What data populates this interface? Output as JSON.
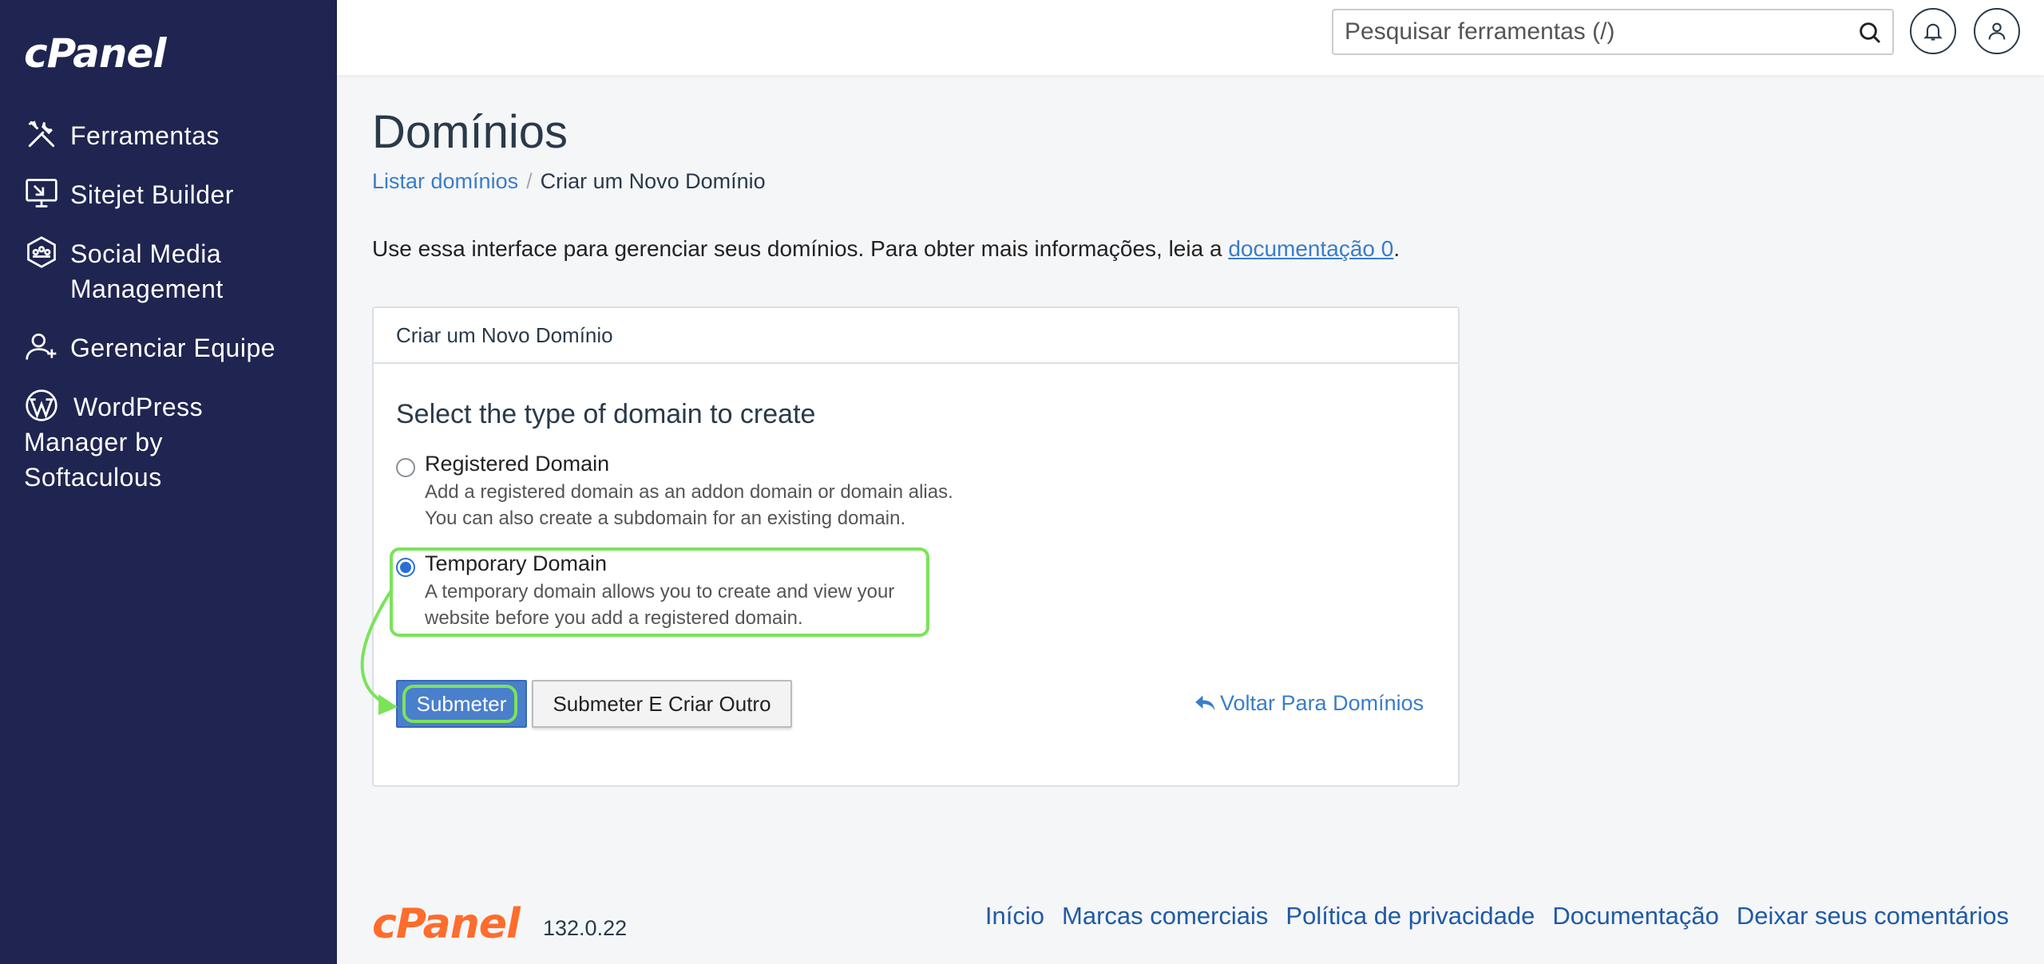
{
  "sidebar": {
    "logo": "cPanel",
    "items": [
      {
        "label": "Ferramentas",
        "icon": "tools-icon"
      },
      {
        "label": "Sitejet Builder",
        "icon": "sitejet-icon"
      },
      {
        "label": "Social Media Management",
        "icon": "social-media-icon"
      },
      {
        "label": "Gerenciar Equipe",
        "icon": "team-icon"
      },
      {
        "label": "WordPress Manager by Softaculous",
        "icon": "wordpress-icon"
      }
    ]
  },
  "topbar": {
    "search_placeholder": "Pesquisar ferramentas (/)"
  },
  "page": {
    "title": "Domínios",
    "breadcrumb": {
      "link": "Listar domínios",
      "current": "Criar um Novo Domínio"
    },
    "intro_text": "Use essa interface para gerenciar seus domínios. Para obter mais informações, leia a",
    "intro_link": "documentação",
    "intro_link_suffix": "0",
    "intro_end": "."
  },
  "panel": {
    "header": "Criar um Novo Domínio",
    "subtitle": "Select the type of domain to create",
    "options": [
      {
        "title": "Registered Domain",
        "desc1": "Add a registered domain as an addon domain or domain alias.",
        "desc2": "You can also create a subdomain for an existing domain.",
        "checked": false
      },
      {
        "title": "Temporary Domain",
        "desc1": "A temporary domain allows you to create and view your",
        "desc2": "website before you add a registered domain.",
        "checked": true
      }
    ],
    "submit_label": "Submeter",
    "submit_another_label": "Submeter E Criar Outro",
    "back_label": "Voltar Para Domínios"
  },
  "footer": {
    "logo": "cPanel",
    "version": "132.0.22",
    "links": [
      "Início",
      "Marcas comerciais",
      "Política de privacidade",
      "Documentação",
      "Deixar seus comentários"
    ]
  },
  "colors": {
    "sidebar_bg": "#1f2550",
    "link": "#3a7dc9",
    "primary_button": "#4a7fcc",
    "highlight": "#7be35a",
    "footer_logo": "#ff6c2c"
  }
}
